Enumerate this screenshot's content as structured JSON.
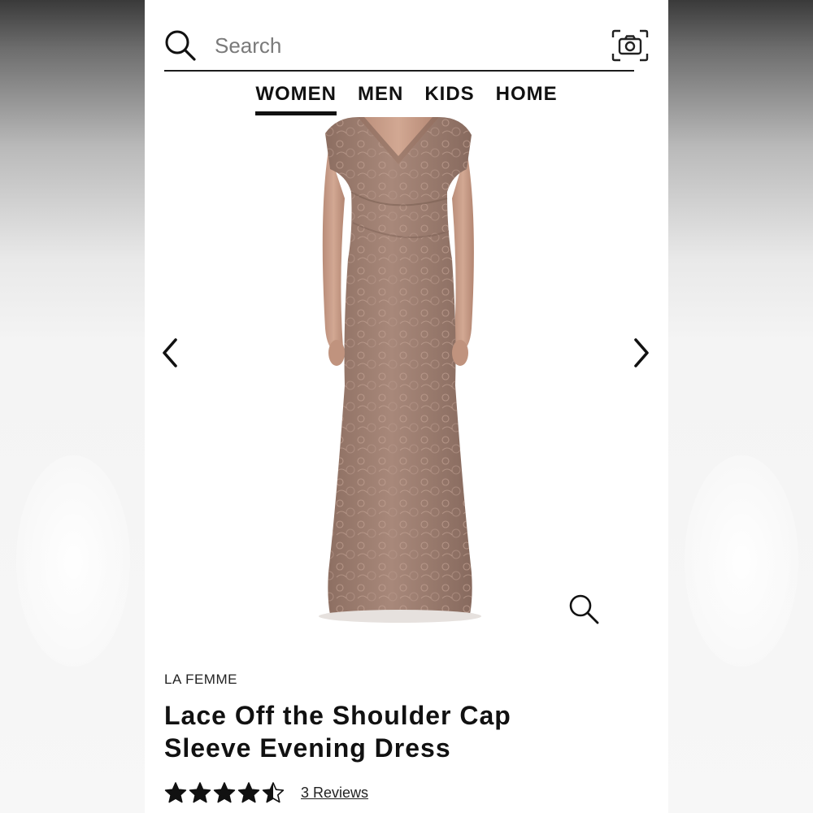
{
  "search": {
    "placeholder": "Search",
    "value": ""
  },
  "nav": {
    "items": [
      {
        "label": "WOMEN",
        "active": true
      },
      {
        "label": "MEN",
        "active": false
      },
      {
        "label": "KIDS",
        "active": false
      },
      {
        "label": "HOME",
        "active": false
      }
    ]
  },
  "product": {
    "brand": "LA FEMME",
    "title_line1": "Lace Off the Shoulder Cap",
    "title_line2": "Sleeve Evening Dress",
    "rating": 4.5,
    "rating_max": 5,
    "reviews_label": "3 Reviews",
    "dress_color": "#9b7c6e"
  },
  "icons": {
    "search": "search-icon",
    "camera": "camera-icon",
    "prev": "chevron-left-icon",
    "next": "chevron-right-icon",
    "zoom": "zoom-icon",
    "star": "star-icon"
  }
}
